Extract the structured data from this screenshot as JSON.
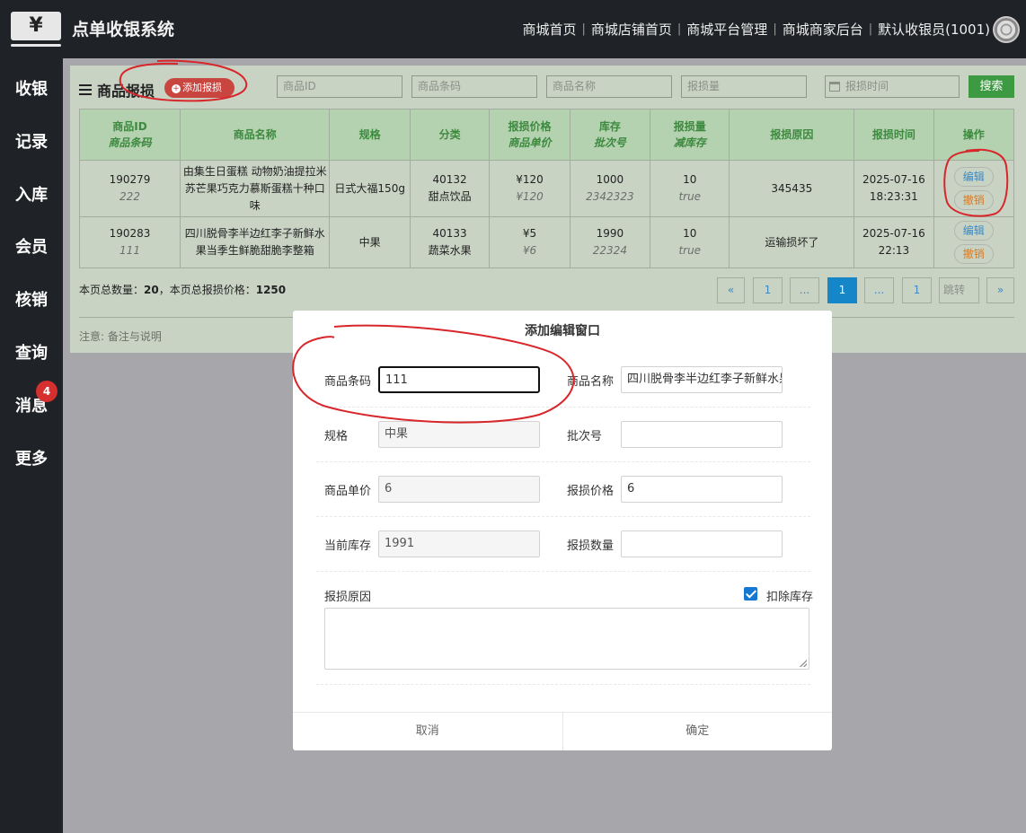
{
  "app": {
    "logo_glyph": "¥",
    "title": "点单收银系统"
  },
  "topnav": [
    "商城首页",
    "商城店铺首页",
    "商城平台管理",
    "商城商家后台",
    "默认收银员(1001)"
  ],
  "sidebar": {
    "items": [
      "收银",
      "记录",
      "入库",
      "会员",
      "核销",
      "查询",
      "消息",
      "更多"
    ],
    "message_badge": "4"
  },
  "panel": {
    "title": "商品报损",
    "add_button": "添加报损",
    "filters": {
      "product_id": "商品ID",
      "barcode": "商品条码",
      "name": "商品名称",
      "loss_qty": "报损量",
      "loss_time": "报损时间"
    },
    "search_button": "搜索"
  },
  "table": {
    "headers": [
      {
        "main": "商品ID",
        "sub": "商品条码"
      },
      {
        "main": "商品名称",
        "sub": ""
      },
      {
        "main": "规格",
        "sub": ""
      },
      {
        "main": "分类",
        "sub": ""
      },
      {
        "main": "报损价格",
        "sub": "商品单价"
      },
      {
        "main": "库存",
        "sub": "批次号"
      },
      {
        "main": "报损量",
        "sub": "减库存"
      },
      {
        "main": "报损原因",
        "sub": ""
      },
      {
        "main": "报损时间",
        "sub": ""
      },
      {
        "main": "操作",
        "sub": ""
      }
    ],
    "rows": [
      {
        "id": "190279",
        "barcode": "222",
        "name": "由集生日蛋糕 动物奶油提拉米苏芒果巧克力慕斯蛋糕十种口味",
        "spec": "日式大福150g",
        "category_code": "40132",
        "category_name": "甜点饮品",
        "loss_price": "¥120",
        "unit_price": "¥120",
        "stock": "1000",
        "batch": "2342323",
        "loss_qty": "10",
        "reduce_stock": "true",
        "reason": "345435",
        "time": "2025-07-16 18:23:31"
      },
      {
        "id": "190283",
        "barcode": "111",
        "name": "四川脱骨李半边红李子新鲜水果当季生鲜脆甜脆李整箱",
        "spec": "中果",
        "category_code": "40133",
        "category_name": "蔬菜水果",
        "loss_price": "¥5",
        "unit_price": "¥6",
        "stock": "1990",
        "batch": "22324",
        "loss_qty": "10",
        "reduce_stock": "true",
        "reason": "运输损坏了",
        "time": "2025-07-16 22:13"
      }
    ],
    "edit_label": "编辑",
    "cancel_label": "撤销"
  },
  "summary": {
    "count_label": "本页总数量：",
    "count": "20",
    "price_label": "，本页总报损价格：",
    "price": "1250"
  },
  "pager": {
    "prev": "«",
    "first": "1",
    "ellipsis1": "...",
    "current": "1",
    "ellipsis2": "...",
    "last": "1",
    "jump_placeholder": "跳转",
    "next": "»"
  },
  "note": "注意: 备注与说明",
  "modal": {
    "title": "添加编辑窗口",
    "fields": {
      "barcode": {
        "label": "商品条码",
        "value": "111"
      },
      "name": {
        "label": "商品名称",
        "value": "四川脱骨李半边红李子新鲜水果"
      },
      "spec": {
        "label": "规格",
        "value": "中果"
      },
      "batch": {
        "label": "批次号",
        "value": ""
      },
      "unit_price": {
        "label": "商品单价",
        "value": "6"
      },
      "loss_price": {
        "label": "报损价格",
        "value": "6"
      },
      "stock": {
        "label": "当前库存",
        "value": "1991"
      },
      "loss_qty": {
        "label": "报损数量",
        "value": ""
      },
      "reason": {
        "label": "报损原因",
        "value": ""
      }
    },
    "deduct_stock_label": "扣除库存",
    "deduct_stock_checked": true,
    "cancel": "取消",
    "confirm": "确定"
  },
  "colors": {
    "topbar": "#1f2226",
    "accent_green": "#3d9a42",
    "add_button_red": "#c9453f",
    "pager_active": "#1586c8",
    "checkbox_blue": "#1677d2",
    "annotation_red": "#d8262a"
  }
}
